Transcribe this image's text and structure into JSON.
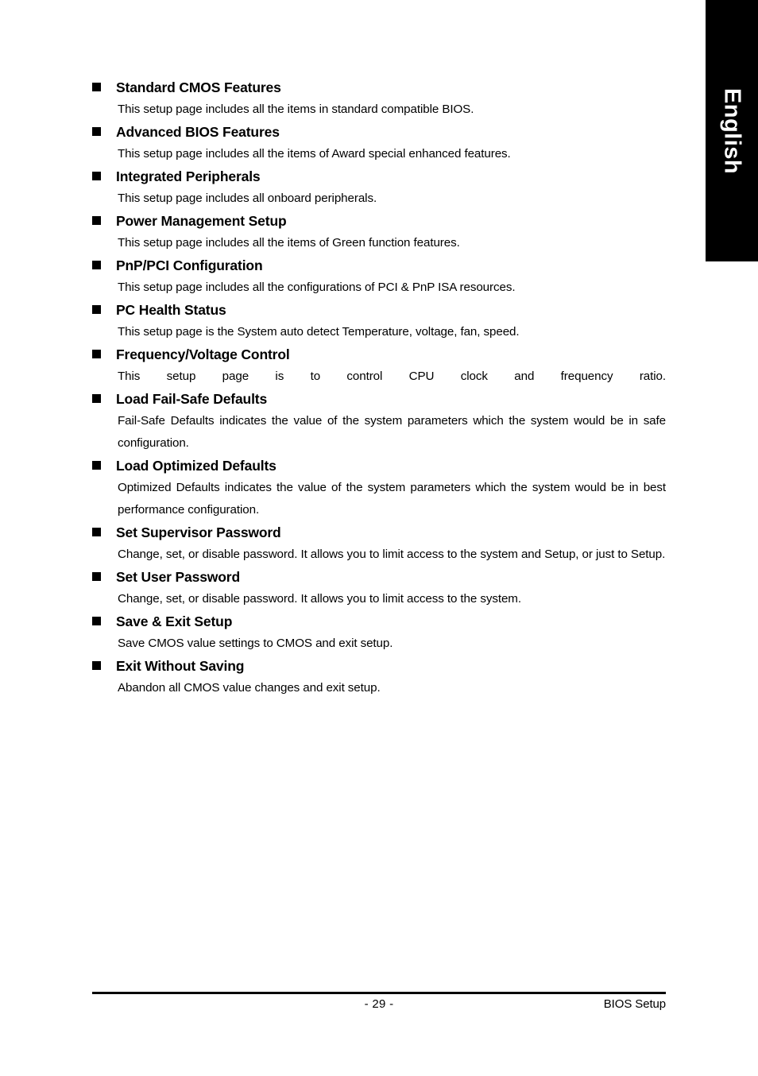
{
  "page": {
    "language_tab": "English",
    "footer": {
      "page_number": "- 29 -",
      "section_label": "BIOS Setup"
    }
  },
  "entries": [
    {
      "title": "Standard CMOS Features",
      "description": "This setup page includes all the items in standard compatible BIOS."
    },
    {
      "title": "Advanced BIOS Features",
      "description": "This setup page includes all the items of Award special enhanced features."
    },
    {
      "title": "Integrated Peripherals",
      "description": "This setup page includes all onboard peripherals."
    },
    {
      "title": "Power Management Setup",
      "description": "This setup page includes all the items of Green function features."
    },
    {
      "title": "PnP/PCI Configuration",
      "description": "This setup page includes all the configurations of PCI & PnP ISA resources."
    },
    {
      "title": "PC Health Status",
      "description": "This setup page is the System auto detect Temperature, voltage, fan, speed."
    },
    {
      "title": "Frequency/Voltage Control",
      "description": "This setup page is to control CPU clock and frequency ratio."
    },
    {
      "title": "Load Fail-Safe Defaults",
      "description": "Fail-Safe Defaults indicates the value of the system parameters which the system would be in safe configuration."
    },
    {
      "title": "Load Optimized Defaults",
      "description": "Optimized Defaults indicates the value of the system parameters which the system would be in best performance configuration."
    },
    {
      "title": "Set Supervisor Password",
      "description": "Change, set, or disable password. It allows you to limit access to the system and Setup, or just to Setup."
    },
    {
      "title": "Set User Password",
      "description": "Change, set, or disable password. It allows you to limit access to the system."
    },
    {
      "title": "Save & Exit Setup",
      "description": "Save CMOS value settings to CMOS and exit setup."
    },
    {
      "title": "Exit Without Saving",
      "description": "Abandon all CMOS value changes and exit setup."
    }
  ]
}
